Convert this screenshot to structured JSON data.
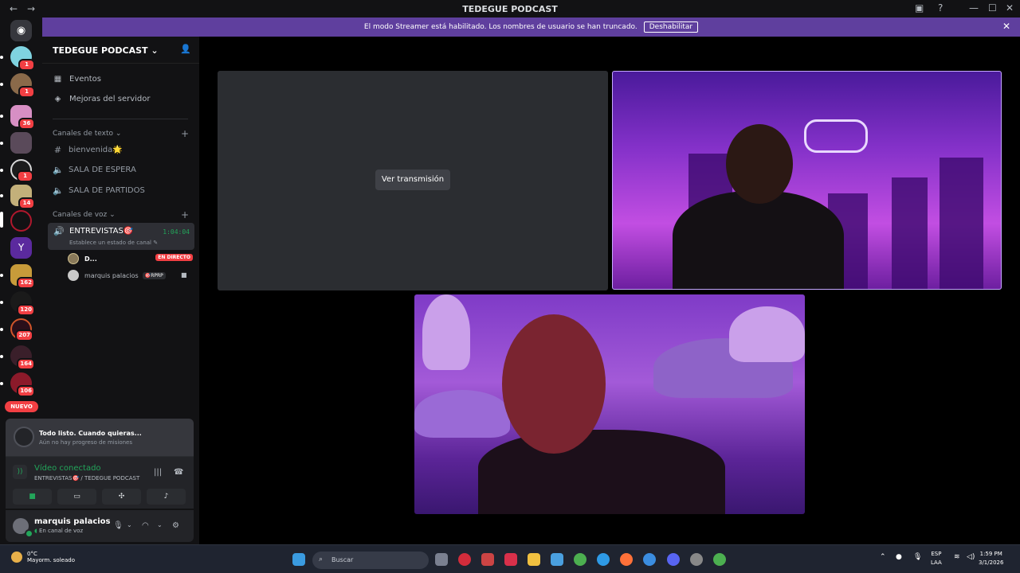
{
  "window": {
    "title": "TEDEGUE PODCAST"
  },
  "banner": {
    "text": "El modo Streamer está habilitado. Los nombres de usuario se han truncado.",
    "disable_label": "Deshabilitar"
  },
  "guilds": {
    "badges": [
      "1",
      "1",
      "36",
      "1",
      "14",
      "162",
      "120",
      "207",
      "164",
      "106"
    ],
    "new_label": "NUEVO"
  },
  "server": {
    "name": "TEDEGUE PODCAST"
  },
  "nav": {
    "events": "Eventos",
    "boosts": "Mejoras del servidor"
  },
  "text_category": "Canales de texto",
  "text_channels": [
    {
      "label": "bienvenida🌟",
      "icon": "hash-icon"
    },
    {
      "label": "SALA DE ESPERA",
      "icon": "speaker-icon"
    },
    {
      "label": "SALA DE PARTIDOS",
      "icon": "speaker-icon"
    }
  ],
  "voice_category": "Canales de voz",
  "voice_channel": {
    "name": "ENTREVISTAS🎯",
    "timer": "1:04:04",
    "status_placeholder": "Establece un estado de canal"
  },
  "voice_users": [
    {
      "name": "D...",
      "live": "EN DIRECTO"
    },
    {
      "name": "marquis palacios",
      "tag": "🎯RPRP"
    }
  ],
  "quest": {
    "title": "Todo listo. Cuando quieras...",
    "subtitle": "Aún no hay progreso de misiones"
  },
  "rtc": {
    "status": "Vídeo conectado",
    "location": "ENTREVISTAS🎯 / TEDEGUE PODCAST"
  },
  "user": {
    "name": "marquis palacios",
    "status": "En canal de voz"
  },
  "stage": {
    "watch_label": "Ver transmisión"
  },
  "taskbar": {
    "temp": "0°C",
    "weather": "Mayorm. soleado",
    "search_placeholder": "Buscar",
    "lang": "ESP",
    "region": "LAA",
    "time": "1:59 PM",
    "date": "3/1/2026"
  },
  "colors": {
    "accent": "#5f3f9e",
    "green": "#23a55a",
    "red": "#f23f43"
  }
}
